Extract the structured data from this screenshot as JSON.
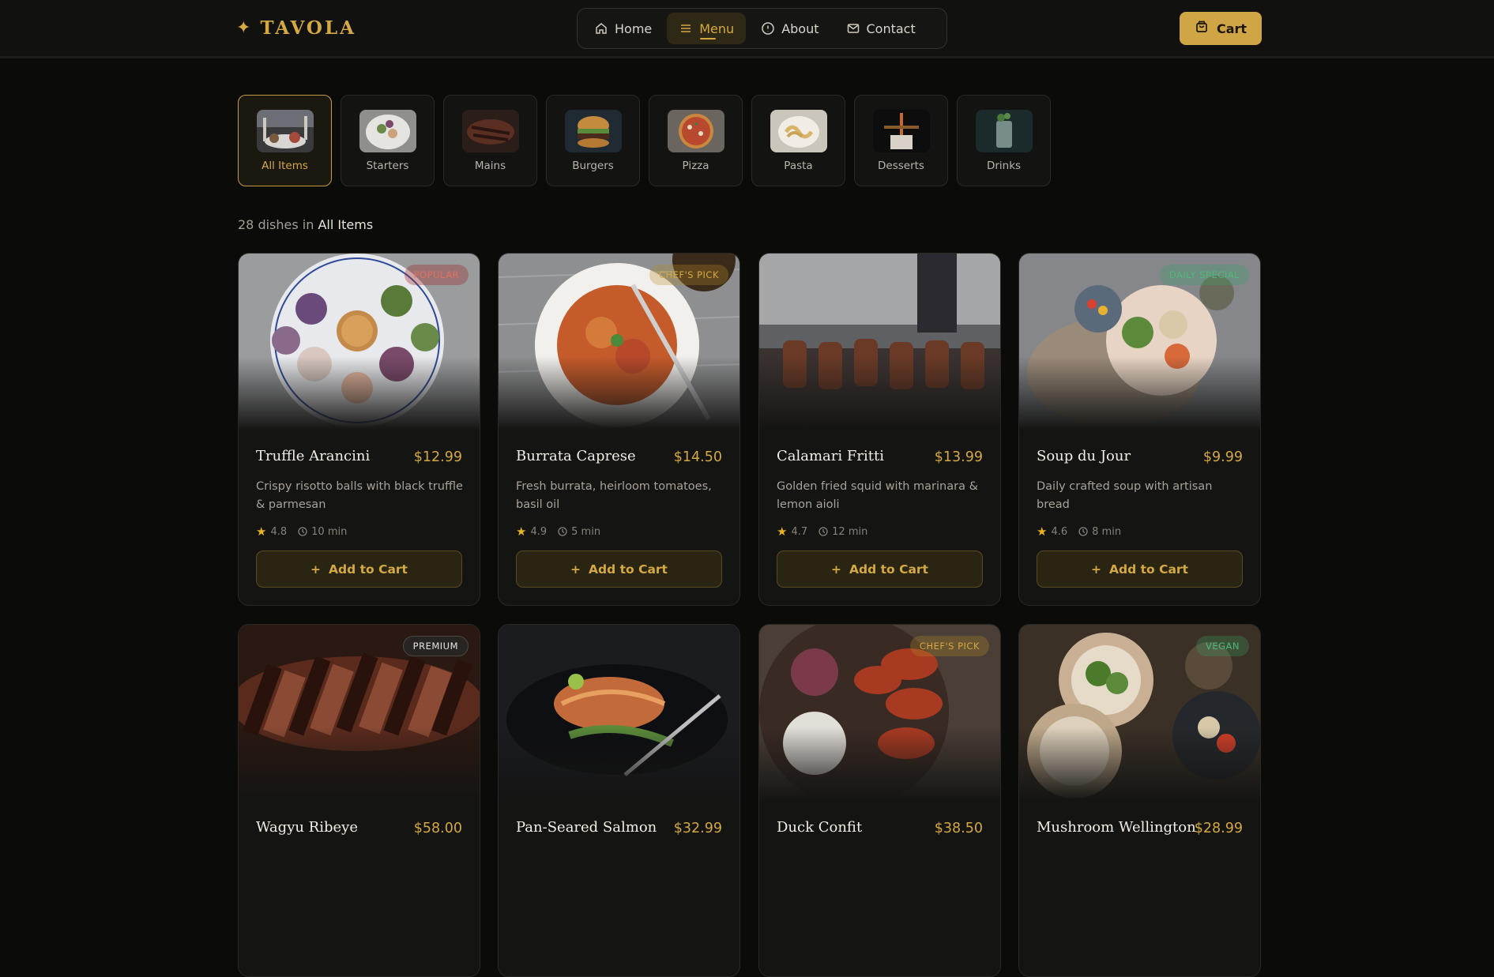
{
  "brand": {
    "name": "TAVOLA"
  },
  "nav": {
    "items": [
      {
        "label": "Home",
        "icon": "home-icon"
      },
      {
        "label": "Menu",
        "icon": "menu-icon",
        "active": true
      },
      {
        "label": "About",
        "icon": "info-icon"
      },
      {
        "label": "Contact",
        "icon": "mail-icon"
      }
    ],
    "cart_label": "Cart"
  },
  "categories": [
    {
      "label": "All Items",
      "active": true
    },
    {
      "label": "Starters"
    },
    {
      "label": "Mains"
    },
    {
      "label": "Burgers"
    },
    {
      "label": "Pizza"
    },
    {
      "label": "Pasta"
    },
    {
      "label": "Desserts"
    },
    {
      "label": "Drinks"
    }
  ],
  "summary": {
    "count_text": "28 dishes in",
    "category": "All Items"
  },
  "add_label": "Add to Cart",
  "dishes": [
    {
      "name": "Truffle Arancini",
      "price": "$12.99",
      "desc": "Crispy risotto balls with black truffle & parmesan",
      "rating": "4.8",
      "time": "10 min",
      "badge": "POPULAR"
    },
    {
      "name": "Burrata Caprese",
      "price": "$14.50",
      "desc": "Fresh burrata, heirloom tomatoes, basil oil",
      "rating": "4.9",
      "time": "5 min",
      "badge": "CHEF'S PICK"
    },
    {
      "name": "Calamari Fritti",
      "price": "$13.99",
      "desc": "Golden fried squid with marinara & lemon aioli",
      "rating": "4.7",
      "time": "12 min",
      "badge": ""
    },
    {
      "name": "Soup du Jour",
      "price": "$9.99",
      "desc": "Daily crafted soup with artisan bread",
      "rating": "4.6",
      "time": "8 min",
      "badge": "DAILY SPECIAL"
    },
    {
      "name": "Wagyu Ribeye",
      "price": "$58.00",
      "desc": "",
      "rating": "",
      "time": "",
      "badge": "PREMIUM"
    },
    {
      "name": "Pan-Seared Salmon",
      "price": "$32.99",
      "desc": "",
      "rating": "",
      "time": "",
      "badge": ""
    },
    {
      "name": "Duck Confit",
      "price": "$38.50",
      "desc": "",
      "rating": "",
      "time": "",
      "badge": "CHEF'S PICK"
    },
    {
      "name": "Mushroom Wellington",
      "price": "$28.99",
      "desc": "",
      "rating": "",
      "time": "",
      "badge": "VEGAN"
    }
  ],
  "colors": {
    "accent": "#d4a843",
    "background": "#0b0b0a",
    "card": "#141413"
  }
}
